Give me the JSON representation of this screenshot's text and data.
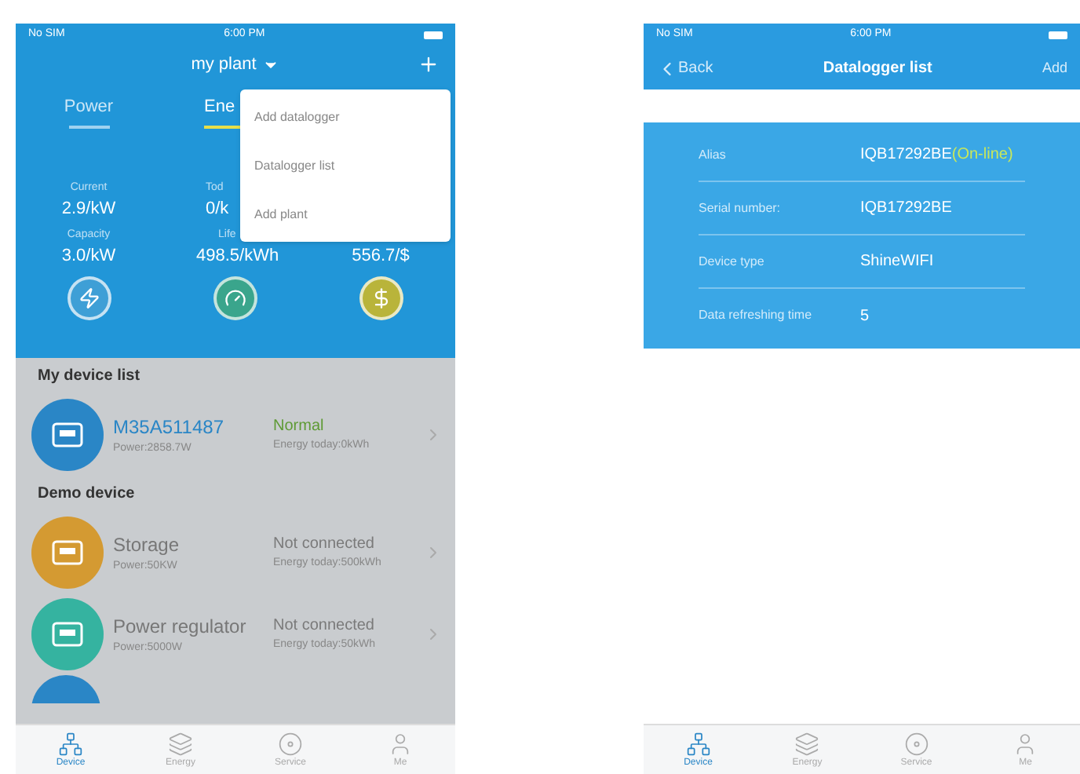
{
  "left_phone": {
    "status_bar": {
      "carrier": "No SIM",
      "time": "6:00 PM"
    },
    "title": "my plant",
    "tabs": [
      {
        "label": "Power",
        "selected": false
      },
      {
        "label": "Ene",
        "selected": true
      }
    ],
    "stats": [
      [
        {
          "label": "Current",
          "value": "2.9/kW"
        },
        {
          "label": "Capacity",
          "value": "3.0/kW"
        }
      ],
      [
        {
          "label": "Tod",
          "value": "0/k"
        },
        {
          "label": "Life",
          "value": "498.5/kWh"
        }
      ],
      [
        {
          "value": "556.7/$"
        }
      ]
    ],
    "menu": [
      "Add datalogger",
      "Datalogger list",
      "Add plant"
    ],
    "sections": [
      {
        "title": "My device list",
        "devices": [
          {
            "kind": "online",
            "name": "M35A511487",
            "status": "Normal",
            "power": "Power:2858.7W",
            "energy": "Energy today:0kWh",
            "color": "#2a86c6"
          }
        ]
      },
      {
        "title": "Demo device",
        "devices": [
          {
            "kind": "offline",
            "name": "Storage",
            "status": "Not connected",
            "power": "Power:50KW",
            "energy": "Energy today:500kWh",
            "color": "#d49a32"
          },
          {
            "kind": "offline",
            "name": "Power regulator",
            "status": "Not connected",
            "power": "Power:5000W",
            "energy": "Energy today:50kWh",
            "color": "#35b3a0"
          },
          {
            "kind": "partial",
            "color": "#2a86c6"
          }
        ]
      }
    ],
    "tab_bar": [
      {
        "label": "Device",
        "selected": true
      },
      {
        "label": "Energy",
        "selected": false
      },
      {
        "label": "Service",
        "selected": false
      },
      {
        "label": "Me",
        "selected": false
      }
    ]
  },
  "right_phone": {
    "status_bar": {
      "carrier": "No SIM",
      "time": "6:00 PM"
    },
    "back": "Back",
    "title": "Datalogger list",
    "add": "Add",
    "rows": [
      {
        "label": "Alias",
        "value": "IQB17292BE",
        "status": "(On-line)"
      },
      {
        "label": "Serial number:",
        "value": "IQB17292BE"
      },
      {
        "label": "Device type",
        "value": "ShineWIFI"
      },
      {
        "label": "Data refreshing time",
        "value": "5"
      }
    ],
    "tab_bar": [
      {
        "label": "Device",
        "selected": true
      },
      {
        "label": "Energy",
        "selected": false
      },
      {
        "label": "Service",
        "selected": false
      },
      {
        "label": "Me",
        "selected": false
      }
    ]
  }
}
